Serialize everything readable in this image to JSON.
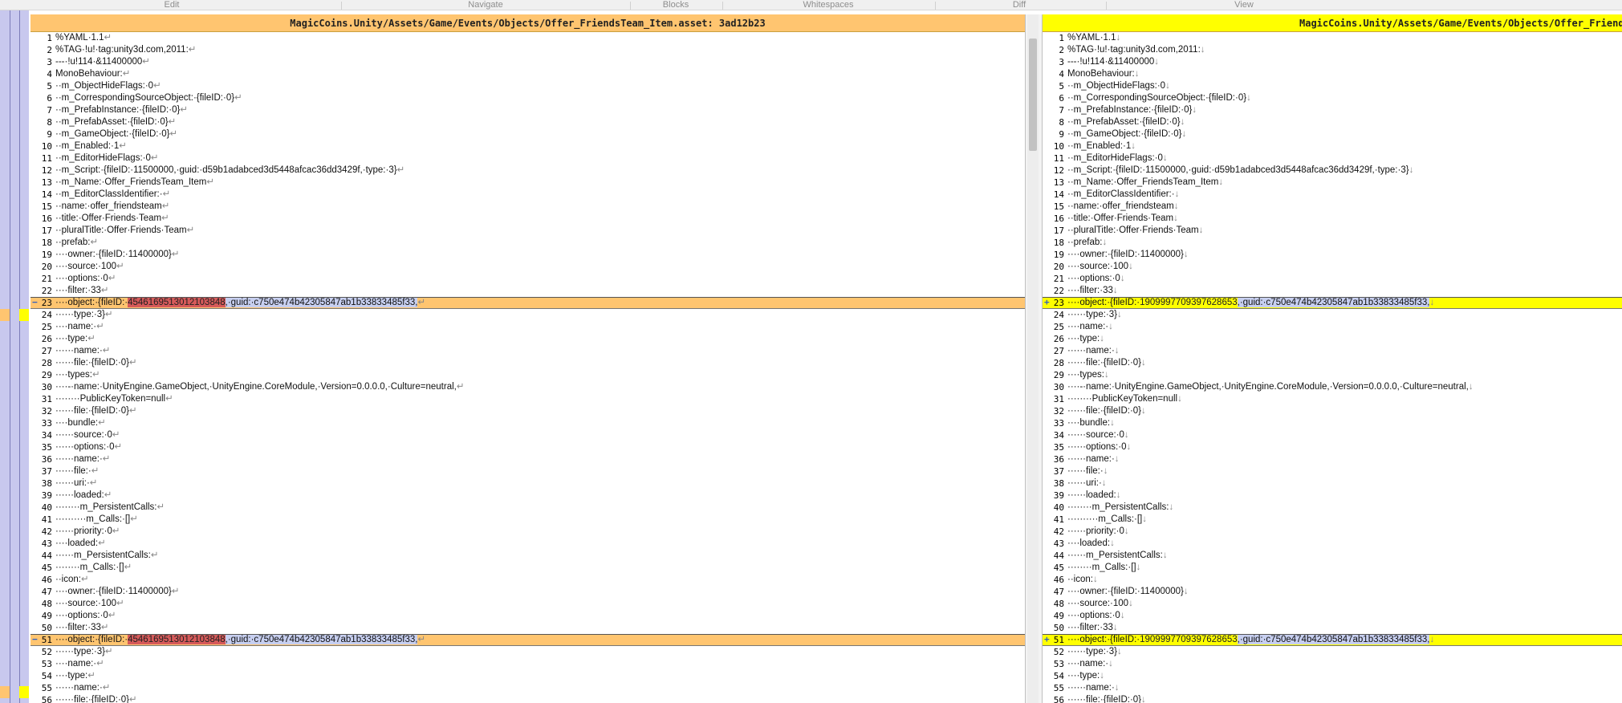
{
  "toolbar": {
    "groups": [
      "Edit",
      "Navigate",
      "Blocks",
      "Whitespaces",
      "Diff",
      "View"
    ]
  },
  "left": {
    "title": "MagicCoins.Unity/Assets/Game/Events/Objects/Offer_FriendsTeam_Item.asset: 3ad12b23",
    "changed_marker": "−",
    "eol": "↵"
  },
  "right": {
    "title": "MagicCoins.Unity/Assets/Game/Events/Objects/Offer_FriendsTeam_Item.asset",
    "changed_marker": "+",
    "eol": "↓"
  },
  "lines": [
    {
      "n": "1",
      "t": "%YAML·1.1"
    },
    {
      "n": "2",
      "t": "%TAG·!u!·tag:unity3d.com,2011:"
    },
    {
      "n": "3",
      "t": "---·!u!114·&11400000"
    },
    {
      "n": "4",
      "t": "MonoBehaviour:"
    },
    {
      "n": "5",
      "t": "··m_ObjectHideFlags:·0"
    },
    {
      "n": "6",
      "t": "··m_CorrespondingSourceObject:·{fileID:·0}"
    },
    {
      "n": "7",
      "t": "··m_PrefabInstance:·{fileID:·0}"
    },
    {
      "n": "8",
      "t": "··m_PrefabAsset:·{fileID:·0}"
    },
    {
      "n": "9",
      "t": "··m_GameObject:·{fileID:·0}"
    },
    {
      "n": "10",
      "t": "··m_Enabled:·1"
    },
    {
      "n": "11",
      "t": "··m_EditorHideFlags:·0"
    },
    {
      "n": "12",
      "t": "··m_Script:·{fileID:·11500000,·guid:·d59b1adabced3d5448afcac36dd3429f,·type:·3}"
    },
    {
      "n": "13",
      "t": "··m_Name:·Offer_FriendsTeam_Item"
    },
    {
      "n": "14",
      "t": "··m_EditorClassIdentifier:·"
    },
    {
      "n": "15",
      "t": "··name:·offer_friendsteam"
    },
    {
      "n": "16",
      "t": "··title:·Offer·Friends·Team"
    },
    {
      "n": "17",
      "t": "··pluralTitle:·Offer·Friends·Team"
    },
    {
      "n": "18",
      "t": "··prefab:"
    },
    {
      "n": "19",
      "t": "····owner:·{fileID:·11400000}"
    },
    {
      "n": "20",
      "t": "····source:·100"
    },
    {
      "n": "21",
      "t": "····options:·0"
    },
    {
      "n": "22",
      "t": "····filter:·33"
    },
    {
      "n": "23",
      "changed": true,
      "pre": "····object:·{fileID:·",
      "left_id": "4546169513012103848",
      "right_id": "1909997709397628653",
      "post": ",·guid:·c750e474b42305847ab1b33833485f33,"
    },
    {
      "n": "24",
      "t": "······type:·3}"
    },
    {
      "n": "25",
      "t": "····name:·"
    },
    {
      "n": "26",
      "t": "····type:"
    },
    {
      "n": "27",
      "t": "······name:·"
    },
    {
      "n": "28",
      "t": "······file:·{fileID:·0}"
    },
    {
      "n": "29",
      "t": "····types:"
    },
    {
      "n": "30",
      "t": "····-·name:·UnityEngine.GameObject,·UnityEngine.CoreModule,·Version=0.0.0.0,·Culture=neutral,"
    },
    {
      "n": "31",
      "t": "········PublicKeyToken=null"
    },
    {
      "n": "32",
      "t": "······file:·{fileID:·0}"
    },
    {
      "n": "33",
      "t": "····bundle:"
    },
    {
      "n": "34",
      "t": "······source:·0"
    },
    {
      "n": "35",
      "t": "······options:·0"
    },
    {
      "n": "36",
      "t": "······name:·"
    },
    {
      "n": "37",
      "t": "······file:·"
    },
    {
      "n": "38",
      "t": "······uri:·"
    },
    {
      "n": "39",
      "t": "······loaded:"
    },
    {
      "n": "40",
      "t": "········m_PersistentCalls:"
    },
    {
      "n": "41",
      "t": "··········m_Calls:·[]"
    },
    {
      "n": "42",
      "t": "······priority:·0"
    },
    {
      "n": "43",
      "t": "····loaded:"
    },
    {
      "n": "44",
      "t": "······m_PersistentCalls:"
    },
    {
      "n": "45",
      "t": "········m_Calls:·[]"
    },
    {
      "n": "46",
      "t": "··icon:"
    },
    {
      "n": "47",
      "t": "····owner:·{fileID:·11400000}"
    },
    {
      "n": "48",
      "t": "····source:·100"
    },
    {
      "n": "49",
      "t": "····options:·0"
    },
    {
      "n": "50",
      "t": "····filter:·33"
    },
    {
      "n": "51",
      "changed": true,
      "pre": "····object:·{fileID:·",
      "left_id": "4546169513012103848",
      "right_id": "1909997709397628653",
      "post": ",·guid:·c750e474b42305847ab1b33833485f33,"
    },
    {
      "n": "52",
      "t": "······type:·3}"
    },
    {
      "n": "53",
      "t": "····name:·"
    },
    {
      "n": "54",
      "t": "····type:"
    },
    {
      "n": "55",
      "t": "······name:·"
    },
    {
      "n": "56",
      "t": "······file:·{fileID:·0}"
    }
  ],
  "colors": {
    "left_changed": "#ffc570",
    "right_changed": "#ffff00",
    "left_token": "#d65a5a",
    "strip": "#c8c8ee"
  }
}
